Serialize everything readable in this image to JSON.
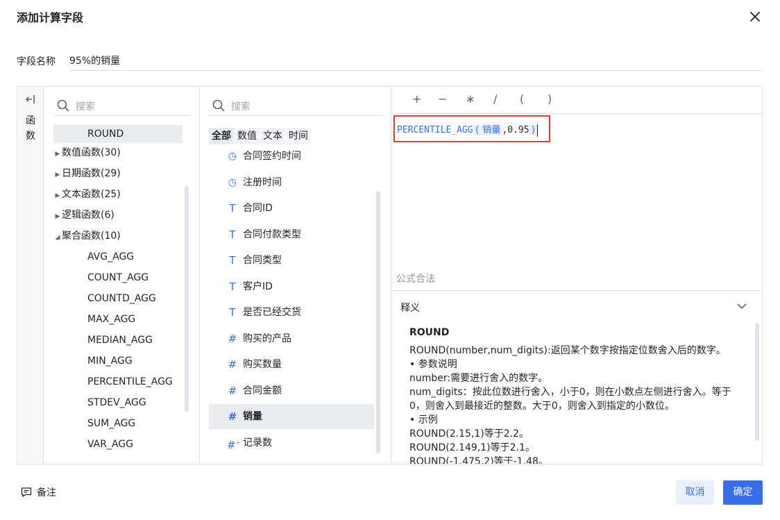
{
  "dialog": {
    "title": "添加计算字段"
  },
  "name_field": {
    "label": "字段名称",
    "value": "95%的销量"
  },
  "rail": {
    "label_chars": [
      "函",
      "数"
    ]
  },
  "functions": {
    "search_placeholder": "搜索",
    "rows": [
      {
        "text": "ROUND",
        "kind": "fn",
        "selected": true
      },
      {
        "text": "数值函数(30)",
        "kind": "group",
        "expanded": false
      },
      {
        "text": "日期函数(29)",
        "kind": "group",
        "expanded": false
      },
      {
        "text": "文本函数(25)",
        "kind": "group",
        "expanded": false
      },
      {
        "text": "逻辑函数(6)",
        "kind": "group",
        "expanded": false
      },
      {
        "text": "聚合函数(10)",
        "kind": "group",
        "expanded": true
      },
      {
        "text": "AVG_AGG",
        "kind": "fn"
      },
      {
        "text": "COUNT_AGG",
        "kind": "fn"
      },
      {
        "text": "COUNTD_AGG",
        "kind": "fn"
      },
      {
        "text": "MAX_AGG",
        "kind": "fn"
      },
      {
        "text": "MEDIAN_AGG",
        "kind": "fn"
      },
      {
        "text": "MIN_AGG",
        "kind": "fn"
      },
      {
        "text": "PERCENTILE_AGG",
        "kind": "fn"
      },
      {
        "text": "STDEV_AGG",
        "kind": "fn"
      },
      {
        "text": "SUM_AGG",
        "kind": "fn"
      },
      {
        "text": "VAR_AGG",
        "kind": "fn"
      }
    ]
  },
  "fields": {
    "search_placeholder": "搜索",
    "tabs": [
      {
        "label": "全部",
        "active": true
      },
      {
        "label": "数值",
        "active": false
      },
      {
        "label": "文本",
        "active": false
      },
      {
        "label": "时间",
        "active": false
      }
    ],
    "rows": [
      {
        "name": "合同签约时间",
        "type": "date"
      },
      {
        "name": "注册时间",
        "type": "date"
      },
      {
        "name": "合同ID",
        "type": "text"
      },
      {
        "name": "合同付款类型",
        "type": "text"
      },
      {
        "name": "合同类型",
        "type": "text"
      },
      {
        "name": "客户ID",
        "type": "text"
      },
      {
        "name": "是否已经交货",
        "type": "text"
      },
      {
        "name": "购买的产品",
        "type": "number"
      },
      {
        "name": "购买数量",
        "type": "number"
      },
      {
        "name": "合同金额",
        "type": "number"
      },
      {
        "name": "销量",
        "type": "number",
        "selected": true
      },
      {
        "name": "记录数",
        "type": "calc"
      }
    ]
  },
  "editor": {
    "operators": [
      "+",
      "−",
      "∗",
      "/",
      "(",
      ")"
    ],
    "formula": {
      "fn": "PERCENTILE_AGG",
      "open": "(",
      "field": "销量",
      "rest": ",0.95",
      "close": ")"
    },
    "validation": "公式合法",
    "description": {
      "header": "释义",
      "fn_name": "ROUND",
      "lines": [
        "ROUND(number,num_digits):返回某个数字按指定位数舍入后的数字。",
        "• 参数说明",
        "number:需要进行舍入的数字。",
        "num_digits：按此位数进行舍入，小于0，则在小数点左侧进行舍入。等于0，则舍入到最接近的整数。大于0，则舍入到指定的小数位。",
        "• 示例",
        "ROUND(2.15,1)等于2.2。",
        "ROUND(2.149,1)等于2.1。",
        "ROUND(-1.475,2)等于-1.48。"
      ]
    }
  },
  "footer": {
    "note_label": "备注",
    "cancel_label": "取消",
    "ok_label": "确定"
  },
  "colors": {
    "accent": "#3a6ee8",
    "highlight_border": "#e53935",
    "selection": "#e8ebf0",
    "border": "#dfe3e8"
  }
}
